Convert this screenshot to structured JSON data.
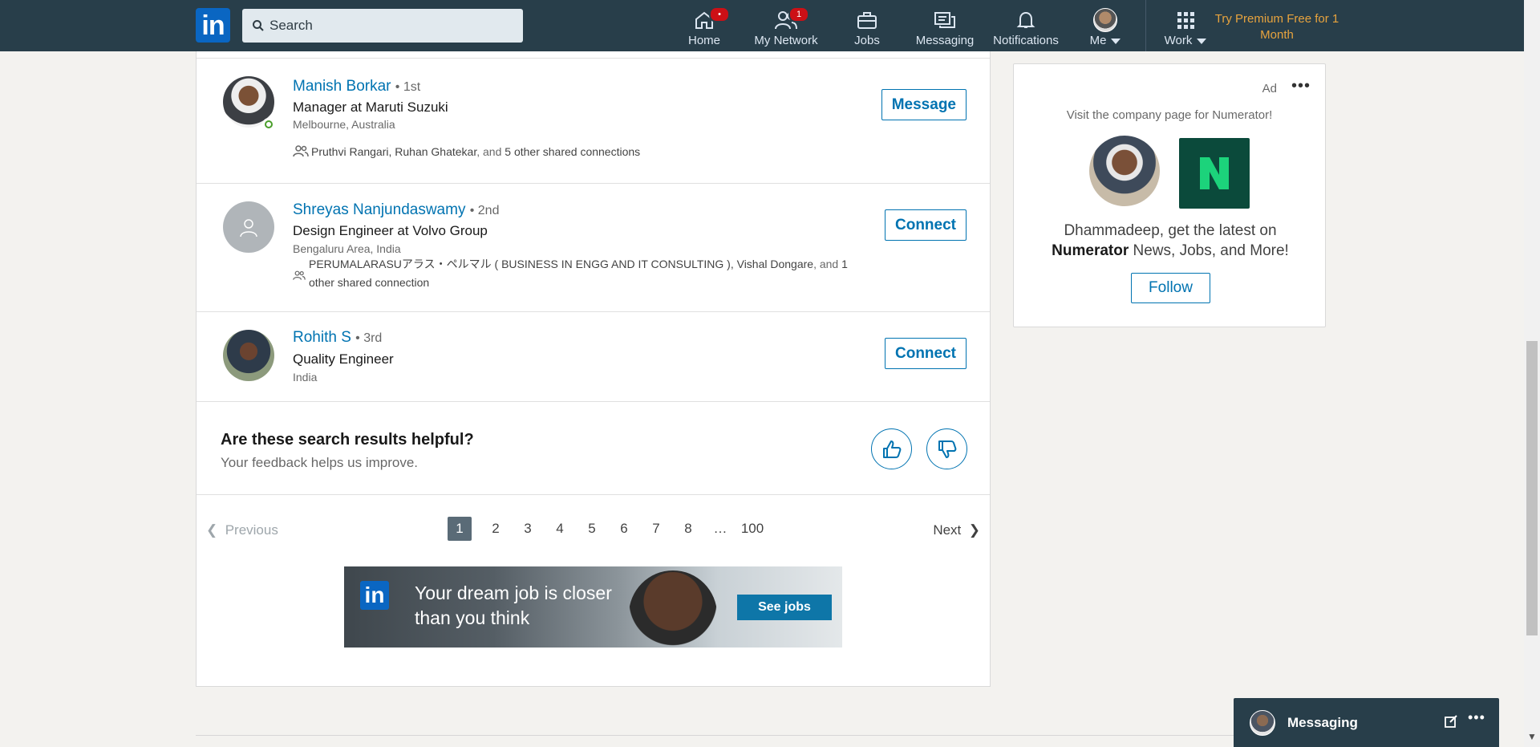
{
  "nav": {
    "search_placeholder": "Search",
    "items": [
      {
        "label": "Home",
        "badge": "•"
      },
      {
        "label": "My Network",
        "badge": "1"
      },
      {
        "label": "Jobs"
      },
      {
        "label": "Messaging"
      },
      {
        "label": "Notifications"
      },
      {
        "label": "Me"
      },
      {
        "label": "Work"
      }
    ],
    "premium": "Try Premium Free for 1 Month"
  },
  "results": [
    {
      "name": "Manish Borkar",
      "degree": "• 1st",
      "headline": "Manager at Maruti Suzuki",
      "location": "Melbourne, Australia",
      "shared": {
        "names": "Pruthvi Rangari, Ruhan Ghatekar",
        "mid": ", and ",
        "others": "5 other shared connections"
      },
      "action": "Message"
    },
    {
      "name": "Shreyas Nanjundaswamy",
      "degree": "• 2nd",
      "headline": "Design Engineer at Volvo Group",
      "location": "Bengaluru Area, India",
      "shared": {
        "names": "PERUMALARASUアラス・ペルマル ( BUSINESS IN ENGG AND IT CONSULTING ), Vishal Dongare",
        "mid": ", and ",
        "others": "1 other shared connection"
      },
      "action": "Connect"
    },
    {
      "name": "Rohith S",
      "degree": "• 3rd",
      "headline": "Quality Engineer",
      "location": "India",
      "action": "Connect"
    }
  ],
  "feedback": {
    "question": "Are these search results helpful?",
    "sub": "Your feedback helps us improve."
  },
  "pagination": {
    "prev": "Previous",
    "next": "Next",
    "pages": [
      "1",
      "2",
      "3",
      "4",
      "5",
      "6",
      "7",
      "8",
      "…",
      "100"
    ],
    "current": "1"
  },
  "banner": {
    "text": "Your dream job is closer than you think",
    "button": "See jobs"
  },
  "ad": {
    "label": "Ad",
    "visit": "Visit the company page for Numerator!",
    "msg_pre": "Dhammadeep, get the latest on",
    "msg_company": "Numerator",
    "msg_post": "News, Jobs, and More!",
    "follow": "Follow"
  },
  "messaging": {
    "title": "Messaging"
  },
  "colors": {
    "brand": "#0073b1",
    "nav_bg": "#283e4a",
    "premium": "#e7a33e",
    "badge": "#cc1016"
  }
}
